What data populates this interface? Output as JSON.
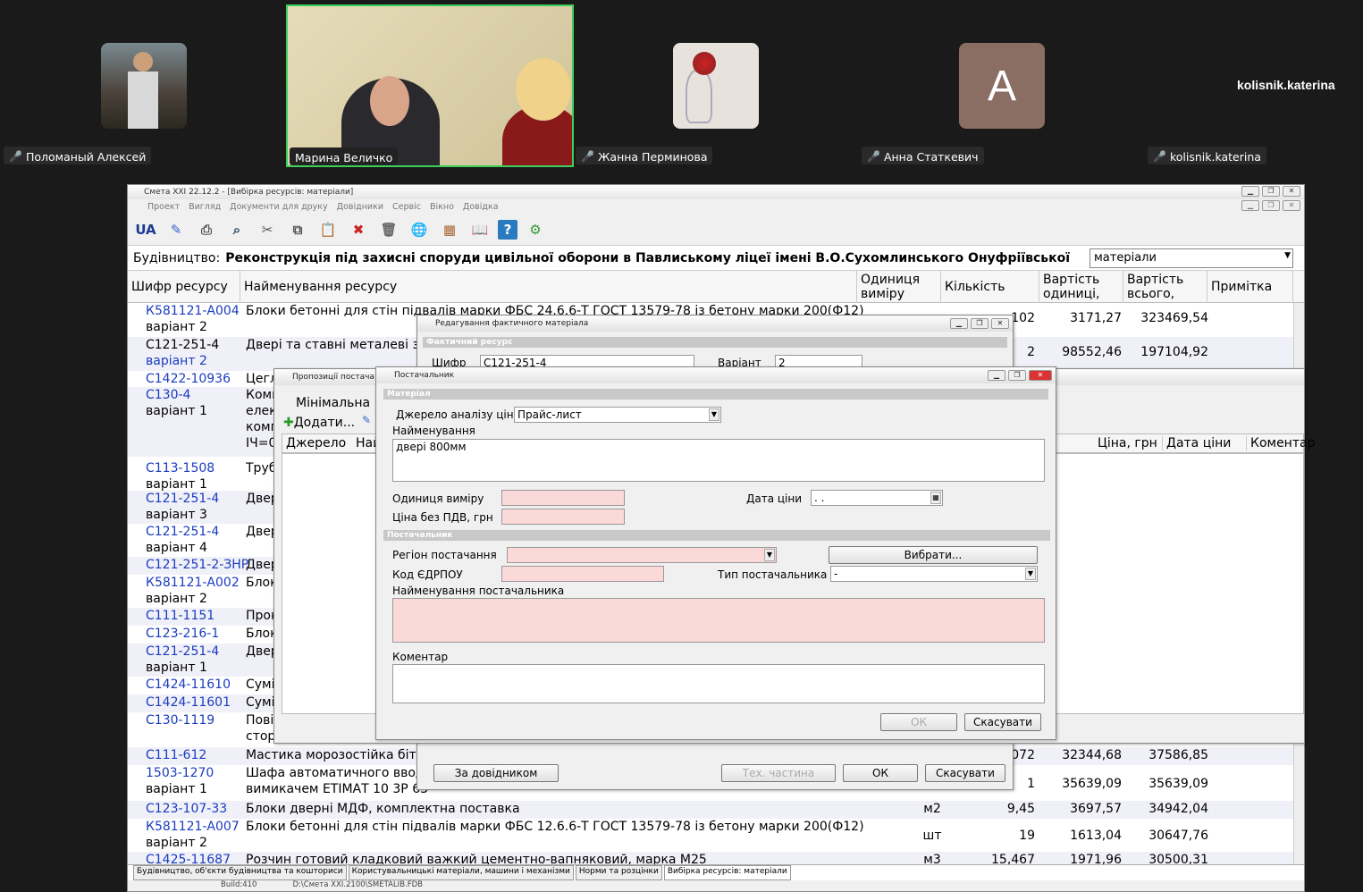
{
  "participants": [
    {
      "name": "Поломаный Алексей"
    },
    {
      "name": "Марина Величко"
    },
    {
      "name": "Жанна Перминова"
    },
    {
      "name": "Анна Статкевич",
      "initial": "А"
    },
    {
      "name": "kolisnik.katerina",
      "display": "kolisnik.katerina"
    }
  ],
  "app": {
    "title": "Смета XXI 22.12.2 - [Вибірка ресурсів: матеріали]",
    "menu": [
      "Проект",
      "Вигляд",
      "Документи для друку",
      "Довідники",
      "Сервіс",
      "Вікно",
      "Довідка"
    ],
    "lang": "UA",
    "project_label": "Будівництво:",
    "project_name": "Реконструкція під захисні споруди цивільної оборони в Павлиському ліцеї імені В.О.Сухомлинського Онуфріївської",
    "filter": "матеріали",
    "columns": {
      "code": "Шифр ресурсу",
      "name": "Найменування ресурсу",
      "unit": "Одиниця виміру",
      "qty": "Кількість",
      "price": "Вартість одиниці,",
      "total": "Вартість всього,",
      "note": "Примітка"
    },
    "rows": [
      {
        "code": "К581121-А004",
        "variant": "варіант 2",
        "name": "Блоки бетонні для стін підвалів марки ФБС 24.6.6-Т ГОСТ 13579-78 із бетону марки 200(Ф12)",
        "unit": "",
        "qty": "102",
        "price": "3171,27",
        "total": "323469,54"
      },
      {
        "code": "С121-251-4",
        "variant": "варіант 2",
        "name": "Двері та ставні металеві захисні",
        "unit": "",
        "qty": "2",
        "price": "98552,46",
        "total": "197104,92"
      },
      {
        "code": "С1422-10936",
        "variant": "",
        "name": "Цегла"
      },
      {
        "code": "С130-4",
        "variant": "варіант 1",
        "name": "Комп",
        "name2": "елек",
        "name3": "комп",
        "name4": "IЧ=0"
      },
      {
        "code": "С113-1508",
        "variant": "варіант 1",
        "name": "Труб"
      },
      {
        "code": "С121-251-4",
        "variant": "варіант 3",
        "name": "Двер"
      },
      {
        "code": "С121-251-4",
        "variant": "варіант 4",
        "name": "Двер"
      },
      {
        "code": "С121-251-2-ЗНР",
        "variant": "",
        "name": "Двер"
      },
      {
        "code": "К581121-А002",
        "variant": "варіант 2",
        "name": "Блок"
      },
      {
        "code": "С111-1151",
        "variant": "",
        "name": "Прок"
      },
      {
        "code": "С123-216-1",
        "variant": "",
        "name": "Блок"
      },
      {
        "code": "С121-251-4",
        "variant": "варіант 1",
        "name": "Двер"
      },
      {
        "code": "С1424-11610",
        "variant": "",
        "name": "Сумі"
      },
      {
        "code": "С1424-11601",
        "variant": "",
        "name": "Сумі"
      },
      {
        "code": "С130-1119",
        "variant": "",
        "name": "Пові",
        "name2": "стор"
      },
      {
        "code": "С111-612",
        "variant": "",
        "name": "Мастика морозостійка бітум",
        "qty": "072",
        "price": "32344,68",
        "total": "37586,85"
      },
      {
        "code": "1503-1270",
        "variant": "варіант 1",
        "name": "Шафа автоматичного вводу",
        "name2": "вимикачем ЕТІМАТ 10 3Р 63",
        "qty": "1",
        "price": "35639,09",
        "total": "35639,09"
      },
      {
        "code": "С123-107-33",
        "variant": "",
        "name": "Блоки дверні МДФ, комплектна поставка",
        "unit": "м2",
        "qty": "9,45",
        "price": "3697,57",
        "total": "34942,04"
      },
      {
        "code": "К581121-А007",
        "variant": "варіант 2",
        "name": "Блоки бетонні для стін підвалів марки ФБС 12.6.6-Т ГОСТ 13579-78 із бетону марки 200(Ф12)",
        "unit": "шт",
        "qty": "19",
        "price": "1613,04",
        "total": "30647,76"
      },
      {
        "code": "С1425-11687",
        "variant": "",
        "name": "Розчин готовий кладковий важкий цементно-вапняковий, марка М25",
        "unit": "м3",
        "qty": "15,467",
        "price": "1971,96",
        "total": "30500,31"
      }
    ],
    "tabs": [
      "Будівництво, об'єкти будівництва та кошториси",
      "Користувальницькі матеріали, машини і механізми",
      "Норми та розцінки",
      "Вибірка ресурсів: матеріали"
    ],
    "status": {
      "build": "Build:410",
      "path": "D:\\Смета XXI.2100\\SMETALIB.FDB"
    }
  },
  "dlg_edit": {
    "title": "Редагування фактичного матеріала",
    "section": "Фактичний ресурс",
    "code_label": "Шифр",
    "code_value": "С121-251-4",
    "variant_label": "Варіант",
    "variant_value": "2",
    "dash": "-",
    "btn_ref": "За довідником",
    "btn_tech": "Тех. частина",
    "btn_ok": "ОК",
    "btn_cancel": "Скасувати"
  },
  "dlg_offers": {
    "title": "Пропозиції постача",
    "min_label": "Мінімальна",
    "add_btn": "Додати...",
    "col_source": "Джерело",
    "col_name": "Най",
    "col_price": "Ціна, грн",
    "col_date": "Дата ціни",
    "col_comment": "Коментар"
  },
  "dlg_supplier": {
    "title": "Постачальник",
    "sect_material": "Матеріал",
    "source_label": "Джерело аналізу цін",
    "source_value": "Прайс-лист",
    "name_label": "Найменування",
    "name_value": "двері 800мм",
    "unit_label": "Одиниця виміру",
    "price_label": "Ціна без ПДВ, грн",
    "date_label": "Дата ціни",
    "date_value": ". .",
    "sect_supplier": "Постачальник",
    "region_label": "Регіон постачання",
    "choose_btn": "Вибрати...",
    "edrpou_label": "Код ЄДРПОУ",
    "type_label": "Тип постачальника",
    "type_value": "-",
    "supname_label": "Найменування постачальника",
    "comment_label": "Коментар",
    "ok": "ОК",
    "cancel": "Скасувати"
  }
}
